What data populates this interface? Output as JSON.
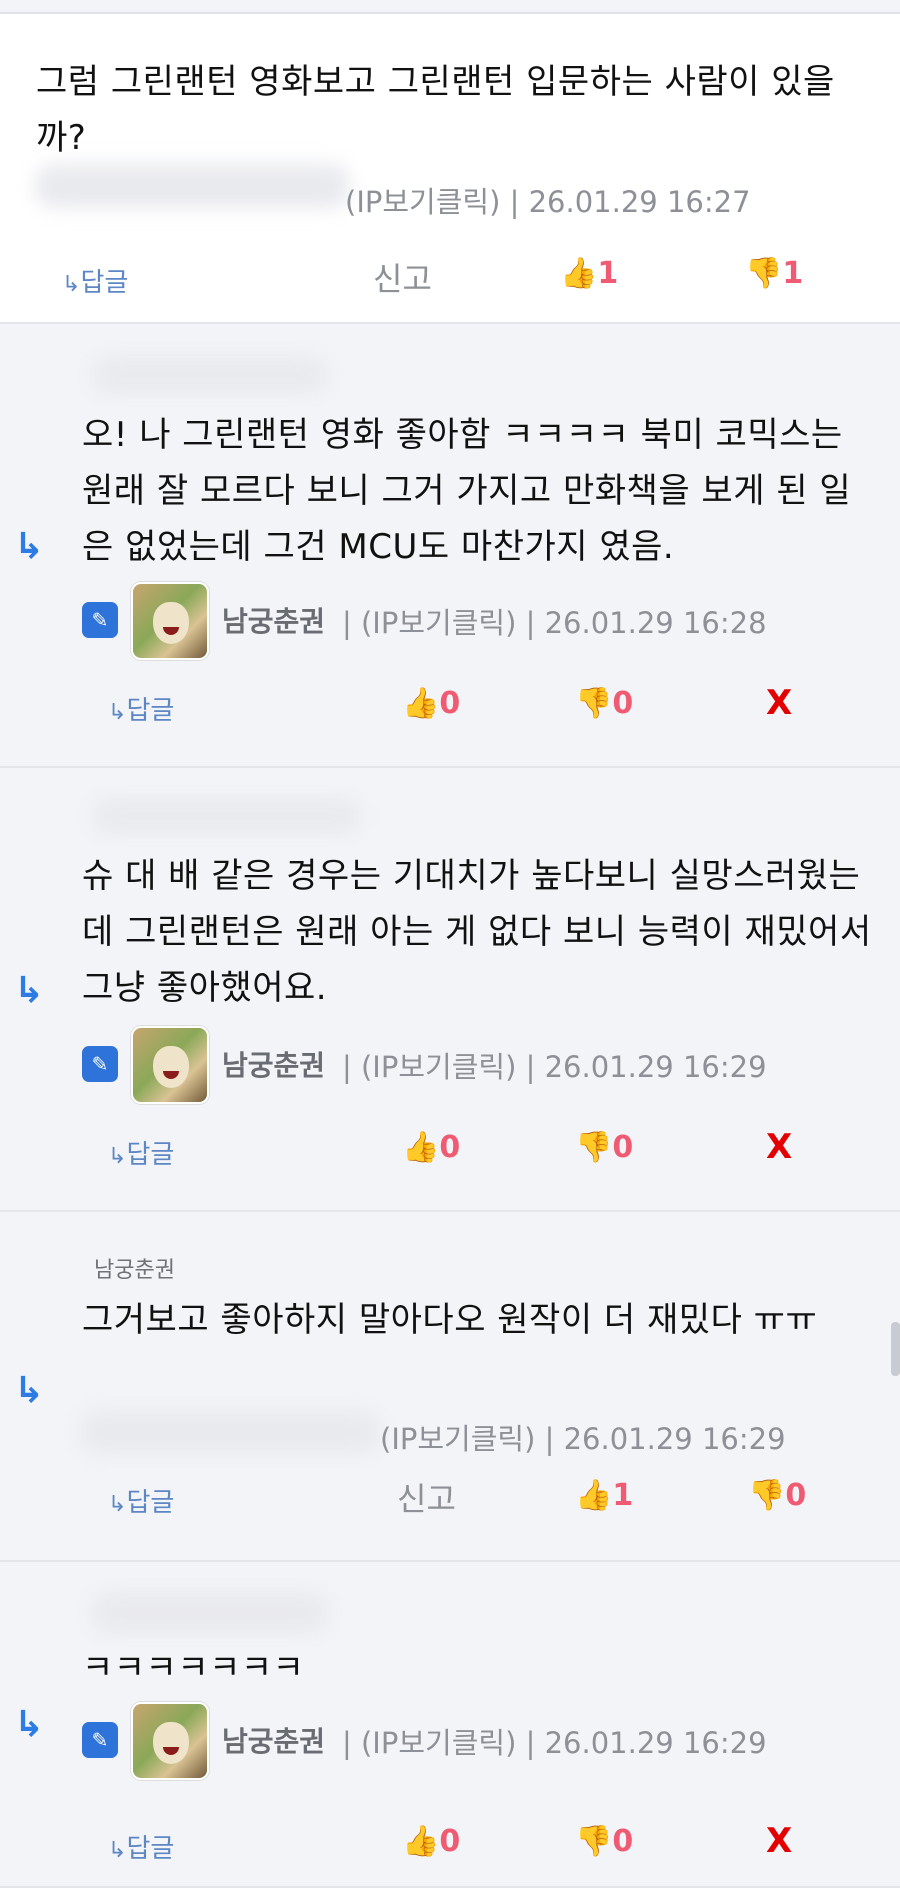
{
  "comments": [
    {
      "body": "그럼 그린랜턴 영화보고 그린랜턴 입문하는 사람이 있을까?",
      "meta": "(IP보기클릭) | 26.01.29 16:27",
      "reply": "답글",
      "report": "신고",
      "up": "1",
      "down": "1"
    },
    {
      "body": "오! 나 그린랜턴 영화 좋아함 ㅋㅋㅋㅋ 북미 코믹스는 원래 잘 모르다 보니 그거 가지고 만화책을 보게 된 일은 없었는데 그건 MCU도 마찬가지 였음.",
      "nick": "남궁춘권",
      "meta": "| (IP보기클릭) | 26.01.29 16:28",
      "reply": "답글",
      "up": "0",
      "down": "0",
      "delete": "X"
    },
    {
      "body": "슈 대 배 같은 경우는 기대치가 높다보니 실망스러웠는데 그린랜턴은 원래 아는 게 없다 보니 능력이 재밌어서 그냥 좋아했어요.",
      "nick": "남궁춘권",
      "meta": "| (IP보기클릭) | 26.01.29 16:29",
      "reply": "답글",
      "up": "0",
      "down": "0",
      "delete": "X"
    },
    {
      "author": "남궁춘권",
      "body": "그거보고 좋아하지 말아다오 원작이 더 재밌다 ㅠㅠ",
      "meta": "(IP보기클릭) | 26.01.29 16:29",
      "reply": "답글",
      "report": "신고",
      "up": "1",
      "down": "0"
    },
    {
      "body": "ㅋㅋㅋㅋㅋㅋㅋ",
      "nick": "남궁춘권",
      "meta": "| (IP보기클릭) | 26.01.29 16:29",
      "reply": "답글",
      "up": "0",
      "down": "0",
      "delete": "X"
    }
  ],
  "icons": {
    "reply_hook": "↳",
    "reply_arrow": "↳",
    "thumb_up": "👍",
    "thumb_down": "👎",
    "edit": "✎"
  },
  "colors": {
    "accent_blue": "#2d73d9",
    "vote_red": "#ef5b72",
    "delete_red": "#e30000"
  }
}
